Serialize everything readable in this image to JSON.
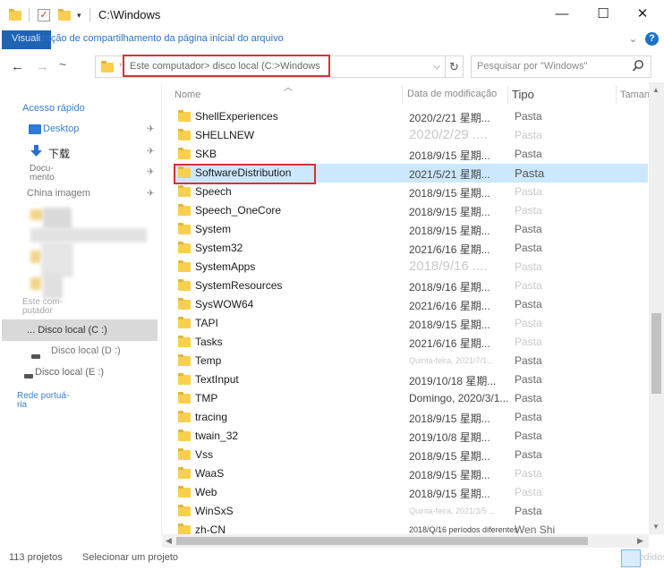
{
  "window": {
    "title": "C:\\Windows",
    "minimize_glyph": "—",
    "maximize_glyph": "☐",
    "close_glyph": "✕"
  },
  "ribbon": {
    "text_prefix": "Visuali",
    "text_rest": "zação de compartilhamento da página inicial do arquivo",
    "expand_glyph": "⌄",
    "help_glyph": "?"
  },
  "nav": {
    "back_glyph": "←",
    "forward_glyph": "→",
    "recent_glyph": "~",
    "address_text": "Este computador> disco local (C:>Windows",
    "address_separator": "›",
    "dropdown_glyph": "⌵",
    "refresh_glyph": "↻",
    "search_placeholder": "Pesquisar por \"Windows\""
  },
  "sidebar": {
    "quick_access": "Acesso rápido",
    "desktop": "Desktop",
    "downloads": "下载",
    "documents_line1": "Docu-",
    "documents_line2": "mento",
    "china_images": "China imagem",
    "this_pc_line1": "Este com-",
    "this_pc_line2": "putador",
    "drive_c": "... Disco local (C :)",
    "drive_d": "Disco local (D :)",
    "drive_e": "Disco local (E :)",
    "network_line1": "Rede portuá-",
    "network_line2": "ria",
    "pin_glyph": "✈"
  },
  "columns": {
    "name": "Nome",
    "date": "Data de modificação",
    "type": "Tipo",
    "size": "Tamanho",
    "sort_glyph": "︿"
  },
  "files": [
    {
      "name": "ShellExperiences",
      "date": "2020/2/21 星期...",
      "type": "Pasta"
    },
    {
      "name": "SHELLNEW",
      "date": "2020/2/29 ....",
      "type": "Pasta",
      "date_style": "faint big",
      "type_style": "faint"
    },
    {
      "name": "SKB",
      "date": "2018/9/15 星期...",
      "type": "Pasta"
    },
    {
      "name": "SoftwareDistribution",
      "date": "2021/5/21 星期...",
      "type": "Pasta",
      "selected": true,
      "type_style": "big"
    },
    {
      "name": "Speech",
      "date": "2018/9/15 星期...",
      "type": "Pasta",
      "type_style": "faint"
    },
    {
      "name": "Speech_OneCore",
      "date": "2018/9/15 星期...",
      "type": "Pasta",
      "type_style": "faint"
    },
    {
      "name": "System",
      "date": "2018/9/15 星期...",
      "type": "Pasta"
    },
    {
      "name": "System32",
      "date": "2021/6/16 星期...",
      "type": "Pasta"
    },
    {
      "name": "SystemApps",
      "date": "2018/9/16 ....",
      "type": "Pasta",
      "date_style": "faint big",
      "type_style": "faint"
    },
    {
      "name": "SystemResources",
      "date": "2018/9/16 星期...",
      "type": "Pasta",
      "type_style": "faint"
    },
    {
      "name": "SysWOW64",
      "date": "2021/6/16 星期...",
      "type": "Pasta"
    },
    {
      "name": "TAPI",
      "date": "2018/9/15 星期...",
      "type": "Pasta",
      "type_style": "faint"
    },
    {
      "name": "Tasks",
      "date": "2021/6/16 星期...",
      "type": "Pasta",
      "type_style": "faint"
    },
    {
      "name": "Temp",
      "date": "Quinta-feira, 2021/7/1...",
      "type": "Pasta",
      "date_style": "faint tiny"
    },
    {
      "name": "TextInput",
      "date": "2019/10/18 星期...",
      "type": "Pasta"
    },
    {
      "name": "TMP",
      "date": "Domingo, 2020/3/1...",
      "type": "Pasta"
    },
    {
      "name": "tracing",
      "date": "2018/9/15 星期...",
      "type": "Pasta"
    },
    {
      "name": "twain_32",
      "date": "2019/10/8 星期...",
      "type": "Pasta"
    },
    {
      "name": "Vss",
      "date": "2018/9/15 星期...",
      "type": "Pasta"
    },
    {
      "name": "WaaS",
      "date": "2018/9/15 星期...",
      "type": "Pasta",
      "type_style": "faint"
    },
    {
      "name": "Web",
      "date": "2018/9/15 星期...",
      "type": "Pasta",
      "type_style": "faint"
    },
    {
      "name": "WinSxS",
      "date": "Quinta-feira, 2021/3/5 ...",
      "type": "Pasta",
      "date_style": "faint tiny"
    },
    {
      "name": "zh-CN",
      "date": "2018/Q/16 períodos diferentes",
      "type": "Wen Shi",
      "date_style": "tiny"
    }
  ],
  "status": {
    "count": "113 projetos",
    "selection": "Selecionar um projeto",
    "right_label": "... pedidos"
  }
}
